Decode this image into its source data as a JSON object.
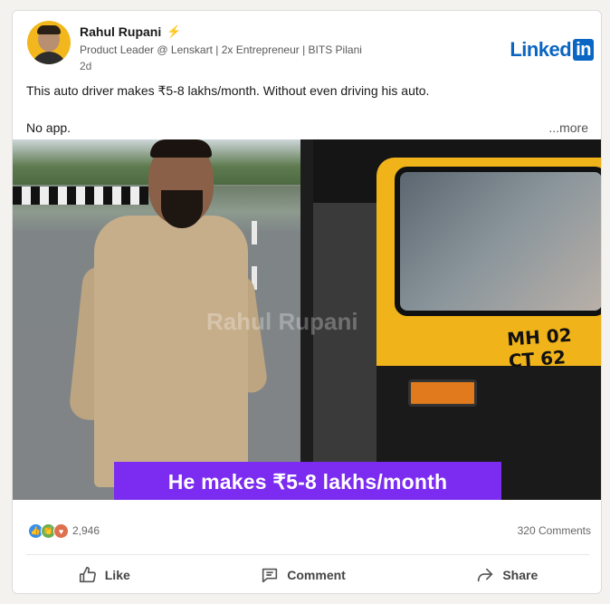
{
  "author": {
    "name": "Rahul Rupani",
    "headline": "Product Leader @ Lenskart | 2x Entrepreneur | BITS Pilani",
    "time": "2d"
  },
  "brand": {
    "text": "Linked",
    "in": "in",
    "color": "#0a66c2"
  },
  "post": {
    "line1": "This auto driver makes ₹5-8 lakhs/month. Without even driving his auto.",
    "line2": "No app.",
    "more": "...more"
  },
  "image": {
    "banner_text": "He makes ₹5-8 lakhs/month",
    "watermark": "Rahul Rupani",
    "plate": "MH 02 CT 62"
  },
  "social": {
    "reactions_count": "2,946",
    "comments": "320 Comments",
    "reaction_icons": [
      "like-icon",
      "celebrate-icon",
      "love-icon"
    ]
  },
  "actions": {
    "like": "Like",
    "comment": "Comment",
    "share": "Share"
  },
  "colors": {
    "banner": "#7b2cf0",
    "accent": "#0a66c2"
  }
}
